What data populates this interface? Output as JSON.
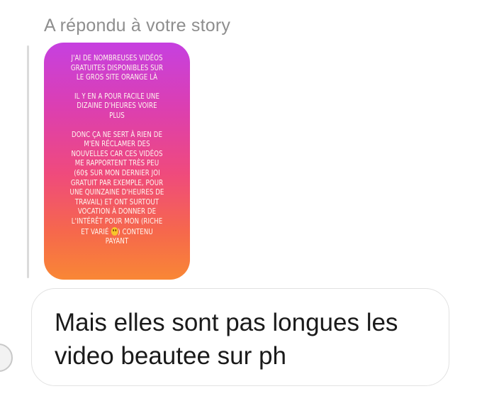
{
  "reply": {
    "header": "A répondu à votre story"
  },
  "story": {
    "paragraphs": [
      "J'AI DE NOMBREUSES VIDÉOS\nGRATUITES DISPONIBLES SUR\nLE GROS SITE ORANGE LÀ",
      "IL Y EN A POUR FACILE UNE\nDIZAINE D'HEURES VOIRE\nPLUS"
    ],
    "paragraph3": "DONC ÇA NE SERT À RIEN DE\nM'EN RÉCLAMER DES\nNOUVELLES CAR CES VIDÉOS\nME RAPPORTENT TRÈS PEU\n(60$ SUR MON DERNIER JOI\nGRATUIT PAR EXEMPLE, POUR\nUNE QUINZAINE D'HEURES DE\nTRAVAIL) ET ONT SURTOUT\nVOCATION À DONNER DE\nL'INTÉRÊT POUR MON (RICHE\nET VARIÉ",
    "paragraph3_end": ") CONTENU\nPAYANT",
    "emoji": "smiling-face-emoji"
  },
  "message": {
    "text": "Mais elles sont pas longues les\nvideo beautee sur ph"
  },
  "colors": {
    "story_gradient_top": "#c640e0",
    "story_gradient_bottom": "#f98735",
    "header_text": "#8e8e8e",
    "bubble_border": "#e2e2e2"
  }
}
